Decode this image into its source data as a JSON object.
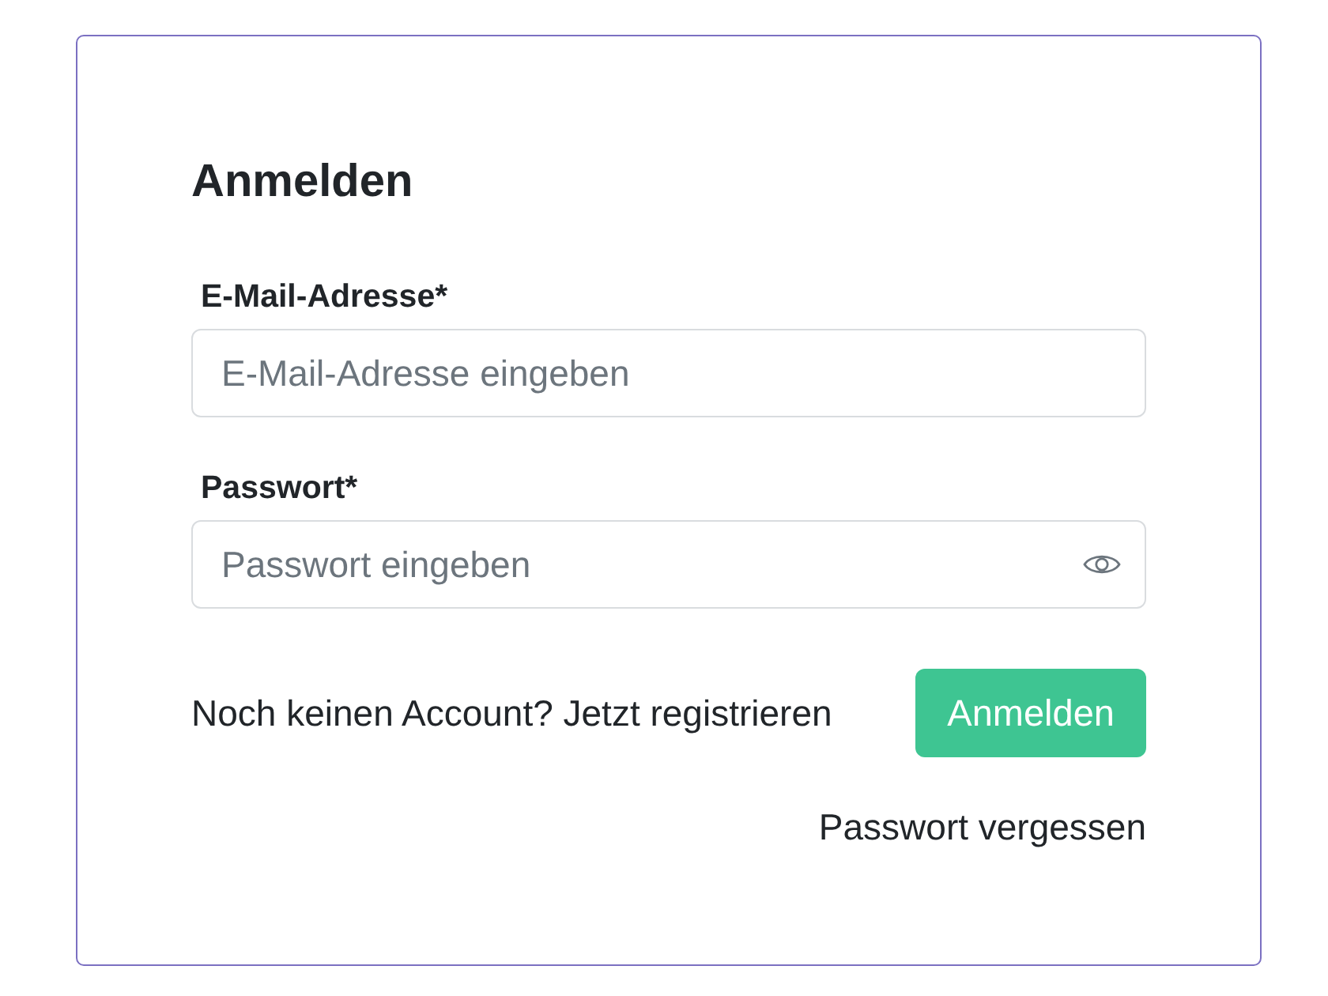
{
  "title": "Anmelden",
  "fields": [
    {
      "kind": "email",
      "label": "E-Mail-Adresse*",
      "placeholder": "E-Mail-Adresse eingeben"
    },
    {
      "kind": "password",
      "label": "Passwort*",
      "placeholder": "Passwort eingeben"
    }
  ],
  "register_prompt": "Noch keinen Account? Jetzt registrieren",
  "submit_button": "Anmelden",
  "forgot_password_link": "Passwort vergessen"
}
